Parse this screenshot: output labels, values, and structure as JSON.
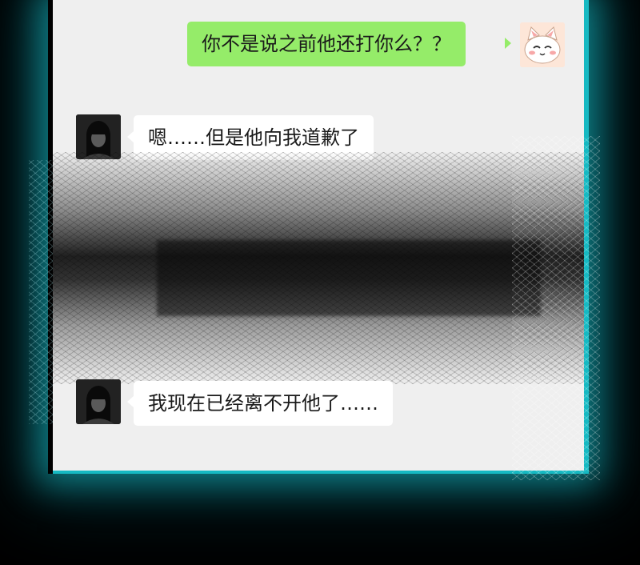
{
  "messages": [
    {
      "side": "out",
      "text": "你不是说之前他还打你么？？",
      "avatar": "cat-avatar-icon"
    },
    {
      "side": "in",
      "text": "嗯……但是他向我道歉了",
      "avatar": "dark-girl-avatar-icon"
    },
    {
      "side": "in",
      "text": "我现在已经离不开他了……",
      "avatar": "dark-girl-avatar-icon"
    }
  ],
  "colors": {
    "screen_bg": "#efefef",
    "outgoing_bubble": "#95ec69",
    "incoming_bubble": "#ffffff",
    "glow": "#16b9c2",
    "background": "#000000"
  }
}
